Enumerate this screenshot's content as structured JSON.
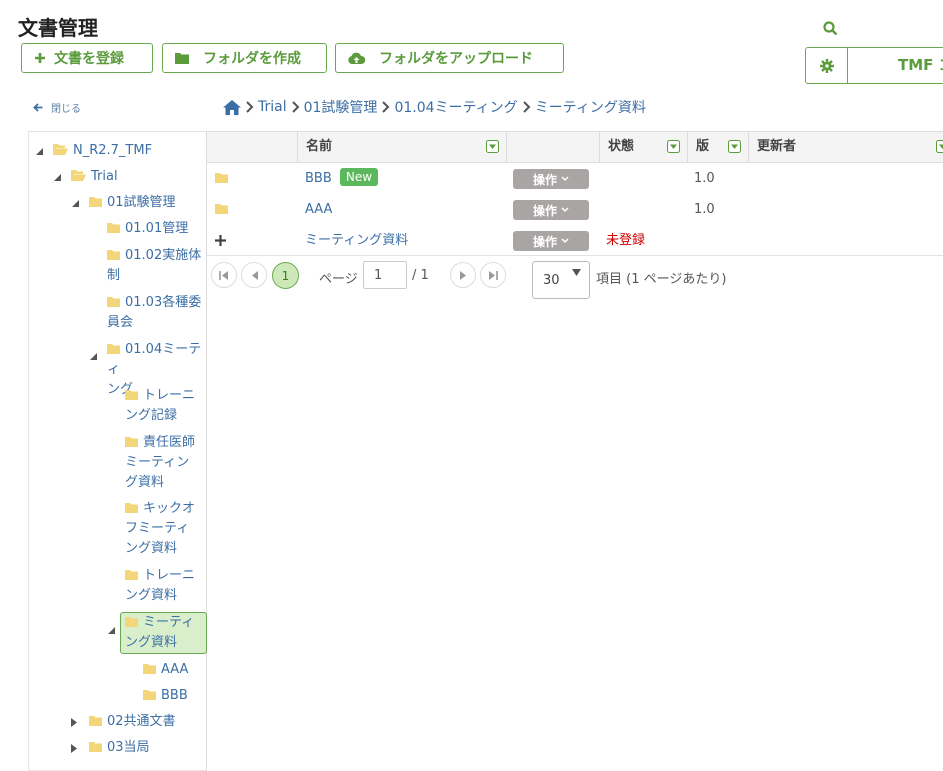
{
  "page": {
    "title": "文書管理"
  },
  "toolbar": {
    "register_label": "文書を登録",
    "create_folder_label": "フォルダを作成",
    "upload_folder_label": "フォルダをアップロード"
  },
  "tmf": {
    "label": "TMF コ"
  },
  "sidebar": {
    "close_label": "閉じる"
  },
  "breadcrumb": [
    "Trial",
    "01試験管理",
    "01.04ミーティング",
    "ミーティング資料"
  ],
  "tree": {
    "root": "N_R2.7_TMF",
    "trial": "Trial",
    "admin": "01試験管理",
    "n0101": "01.01管理",
    "n0102": [
      "01.02実施体",
      "制"
    ],
    "n0103": [
      "01.03各種委",
      "員会"
    ],
    "n0104": [
      "01.04ミーティ",
      "ング"
    ],
    "training_record": [
      "トレーニ",
      "ング記録"
    ],
    "pi_meeting": [
      "責任医師",
      "ミーティン",
      "グ資料"
    ],
    "kickoff": [
      "キックオ",
      "フミーティ",
      "ング資料"
    ],
    "training_docs": [
      "トレーニ",
      "ング資料"
    ],
    "meeting_docs": [
      "ミーティ",
      "ング資料"
    ],
    "aaa": "AAA",
    "bbb": "BBB",
    "common": "02共通文書",
    "authority": "03当局"
  },
  "grid": {
    "headers": {
      "name": "名前",
      "status": "状態",
      "version": "版",
      "updater": "更新者"
    },
    "op_label": "操作",
    "new_badge": "New",
    "rows": [
      {
        "name": "BBB",
        "version": "1.0",
        "status": ""
      },
      {
        "name": "AAA",
        "version": "1.0",
        "status": ""
      },
      {
        "name": "ミーティング資料",
        "version": "",
        "status": "未登録"
      }
    ]
  },
  "pager": {
    "current": "1",
    "page_label": "ページ",
    "page_value": "1",
    "total": "/ 1",
    "per_page": "30",
    "items_label": "項目 (1 ページあたり)"
  },
  "colors": {
    "accent": "#5b9b3c",
    "link": "#3b6ea5",
    "folder": "#f3d57a",
    "error": "#cc0000"
  }
}
